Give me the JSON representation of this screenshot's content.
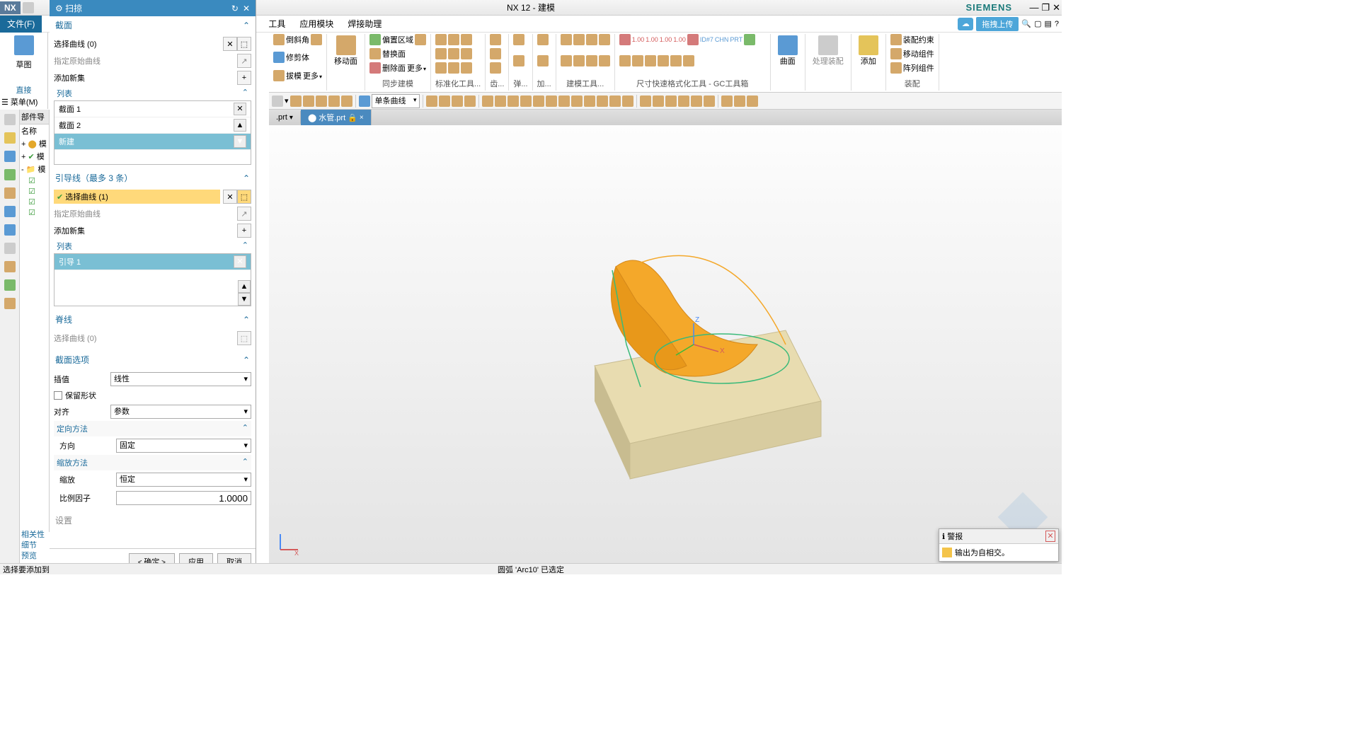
{
  "title": "NX 12 - 建模",
  "brand": "SIEMENS",
  "nx_logo": "NX",
  "menu": {
    "file": "文件(F)",
    "tool": "工具",
    "module": "应用模块",
    "weld": "焊接助理"
  },
  "upload_pill": "拖拽上传",
  "ribbon": {
    "chamfer": "倒斜角",
    "trim": "修剪体",
    "draft": "拔模",
    "more1": "更多",
    "moveface": "移动面",
    "offset": "偏置区域",
    "replace": "替换面",
    "delete": "删除面",
    "more2": "更多",
    "sync_label": "同步建模",
    "std_label": "标准化工具...",
    "hole_label": "齿...",
    "spring_label": "弹...",
    "add_label": "加...",
    "model_label": "建模工具...",
    "dim_label": "尺寸快速格式化工具 - GC工具箱",
    "surface": "曲面",
    "process": "处理装配",
    "addcomp": "添加",
    "assy_constraint": "装配约束",
    "movecomp": "移动组件",
    "pattern": "阵列组件",
    "assy_label": "装配"
  },
  "combo_curve": "单条曲线",
  "sketch": {
    "label": "草图",
    "direct": "直接",
    "menu": "菜单(M)"
  },
  "filetabs": {
    "prt1": ".prt",
    "prt2": "水管.prt"
  },
  "partnav": {
    "header": "部件导",
    "name": "名称"
  },
  "dialog": {
    "title": "扫掠",
    "sec_section": "截面",
    "select_curve": "选择曲线 (0)",
    "orig_curve": "指定原始曲线",
    "add_set": "添加新集",
    "list": "列表",
    "items": [
      "截面 1",
      "截面 2",
      "新建"
    ],
    "sec_guide": "引导线（最多 3 条）",
    "select_curve_g": "选择曲线 (1)",
    "guide_items": [
      "引导 1"
    ],
    "sec_spine": "脊线",
    "spine_select": "选择曲线 (0)",
    "sec_options": "截面选项",
    "interp_label": "插值",
    "interp_val": "线性",
    "preserve": "保留形状",
    "align_label": "对齐",
    "align_val": "参数",
    "orient_header": "定向方法",
    "dir_label": "方向",
    "dir_val": "固定",
    "scale_header": "缩放方法",
    "scale_label": "缩放",
    "scale_val": "恒定",
    "factor_label": "比例因子",
    "factor_val": "1.0000",
    "settings": "设置",
    "ok": "确定",
    "apply": "应用",
    "cancel": "取消"
  },
  "left_labels": {
    "rel": "相关性",
    "detail": "细节",
    "preview": "预览"
  },
  "status_left": "选择要添加到",
  "status_center": "圆弧 'Arc10' 已选定",
  "alert": {
    "title": "警报",
    "msg": "输出为自相交。"
  }
}
